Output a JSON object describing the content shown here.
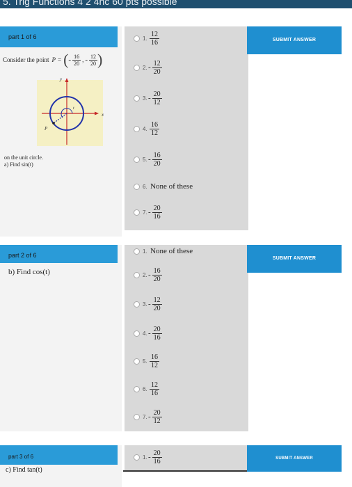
{
  "topbar": {
    "title": "5. Trig Functions 4 2 4nc 60 pts possible"
  },
  "parts": [
    {
      "header": "part 1 of 6",
      "prompt_prefix": "Consider the point",
      "point_label": "P",
      "point_eq": "=",
      "point_x": {
        "sign": "-",
        "num": "16",
        "den": "20"
      },
      "point_y": {
        "sign": "-",
        "num": "12",
        "den": "20"
      },
      "graph": {
        "y_label": "y",
        "x_label": "x",
        "t_label": "t",
        "p_label": "P"
      },
      "line1": "on the unit circle.",
      "line2": "a) Find sin(t)",
      "submit": "SUBMIT ANSWER",
      "choices": [
        {
          "n": "1.",
          "sign": "",
          "num": "12",
          "den": "16"
        },
        {
          "n": "2.",
          "sign": "-",
          "num": "12",
          "den": "20"
        },
        {
          "n": "3.",
          "sign": "-",
          "num": "20",
          "den": "12"
        },
        {
          "n": "4.",
          "sign": "",
          "num": "16",
          "den": "12"
        },
        {
          "n": "5.",
          "sign": "-",
          "num": "16",
          "den": "20"
        },
        {
          "n": "6.",
          "text": "None of these"
        },
        {
          "n": "7.",
          "sign": "-",
          "num": "20",
          "den": "16"
        }
      ]
    },
    {
      "header": "part 2 of 6",
      "prompt": "b) Find cos(t)",
      "submit": "SUBMIT ANSWER",
      "choices": [
        {
          "n": "1.",
          "text": "None of these"
        },
        {
          "n": "2.",
          "sign": "-",
          "num": "16",
          "den": "20"
        },
        {
          "n": "3.",
          "sign": "-",
          "num": "12",
          "den": "20"
        },
        {
          "n": "4.",
          "sign": "-",
          "num": "20",
          "den": "16"
        },
        {
          "n": "5.",
          "sign": "",
          "num": "16",
          "den": "12"
        },
        {
          "n": "6.",
          "sign": "",
          "num": "12",
          "den": "16"
        },
        {
          "n": "7.",
          "sign": "-",
          "num": "20",
          "den": "12"
        }
      ]
    },
    {
      "header": "part 3 of 6",
      "prompt": "c) Find tan(t)",
      "submit": "SUBMIT ANSWER",
      "choices": [
        {
          "n": "1.",
          "sign": "-",
          "num": "20",
          "den": "16"
        }
      ]
    }
  ],
  "colors": {
    "header_blue": "#2a9bd8",
    "submit_blue": "#1f8fd0",
    "choice_bg": "#d9d9d9",
    "graph_bg": "#f5f0c4",
    "circle_blue": "#2233aa"
  }
}
